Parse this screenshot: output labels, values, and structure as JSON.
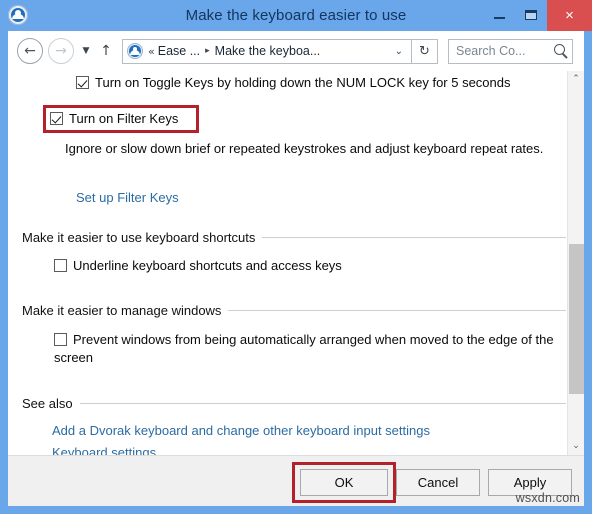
{
  "window": {
    "title": "Make the keyboard easier to use",
    "icon": "ease-of-access-icon",
    "controls": {
      "minimize": "minimize-icon",
      "maximize": "maximize-icon",
      "close": "×"
    },
    "accent_color": "#6aa6ea",
    "close_color": "#d94f4f"
  },
  "navbar": {
    "back": "←",
    "forward": "→",
    "history_caret": "▼",
    "up": "↑",
    "address": {
      "icon": "ease-of-access-icon",
      "separator": "«",
      "crumb1": "Ease ...",
      "crumb_arrow": "▸",
      "crumb2": "Make the keyboa...",
      "dropdown": "⌄"
    },
    "refresh": "↻",
    "search": {
      "placeholder": "Search Co...",
      "icon": "search-icon"
    }
  },
  "content": {
    "toggle_keys": {
      "label": "Turn on Toggle Keys by holding down the NUM LOCK key for 5 seconds",
      "checked": true
    },
    "filter_keys": {
      "label": "Turn on Filter Keys",
      "checked": true,
      "highlighted": true,
      "highlight_color": "#b3222c"
    },
    "filter_keys_description": "Ignore or slow down brief or repeated keystrokes and adjust keyboard repeat rates.",
    "setup_filter_keys_link": "Set up Filter Keys",
    "shortcuts_group": {
      "heading": "Make it easier to use keyboard shortcuts",
      "underline_shortcuts": {
        "label": "Underline keyboard shortcuts and access keys",
        "checked": false
      }
    },
    "windows_group": {
      "heading": "Make it easier to manage windows",
      "prevent_arrange": {
        "label": "Prevent windows from being automatically arranged when moved to the edge of the screen",
        "checked": false
      }
    },
    "see_also": {
      "heading": "See also",
      "link1": "Add a Dvorak keyboard and change other keyboard input settings",
      "link2": "Keyboard settings"
    }
  },
  "scrollbar": {
    "up_arrow": "⌃",
    "down_arrow": "⌄"
  },
  "footer": {
    "ok": "OK",
    "cancel": "Cancel",
    "apply": "Apply",
    "ok_highlighted": true
  },
  "watermark": "wsxdn.com"
}
